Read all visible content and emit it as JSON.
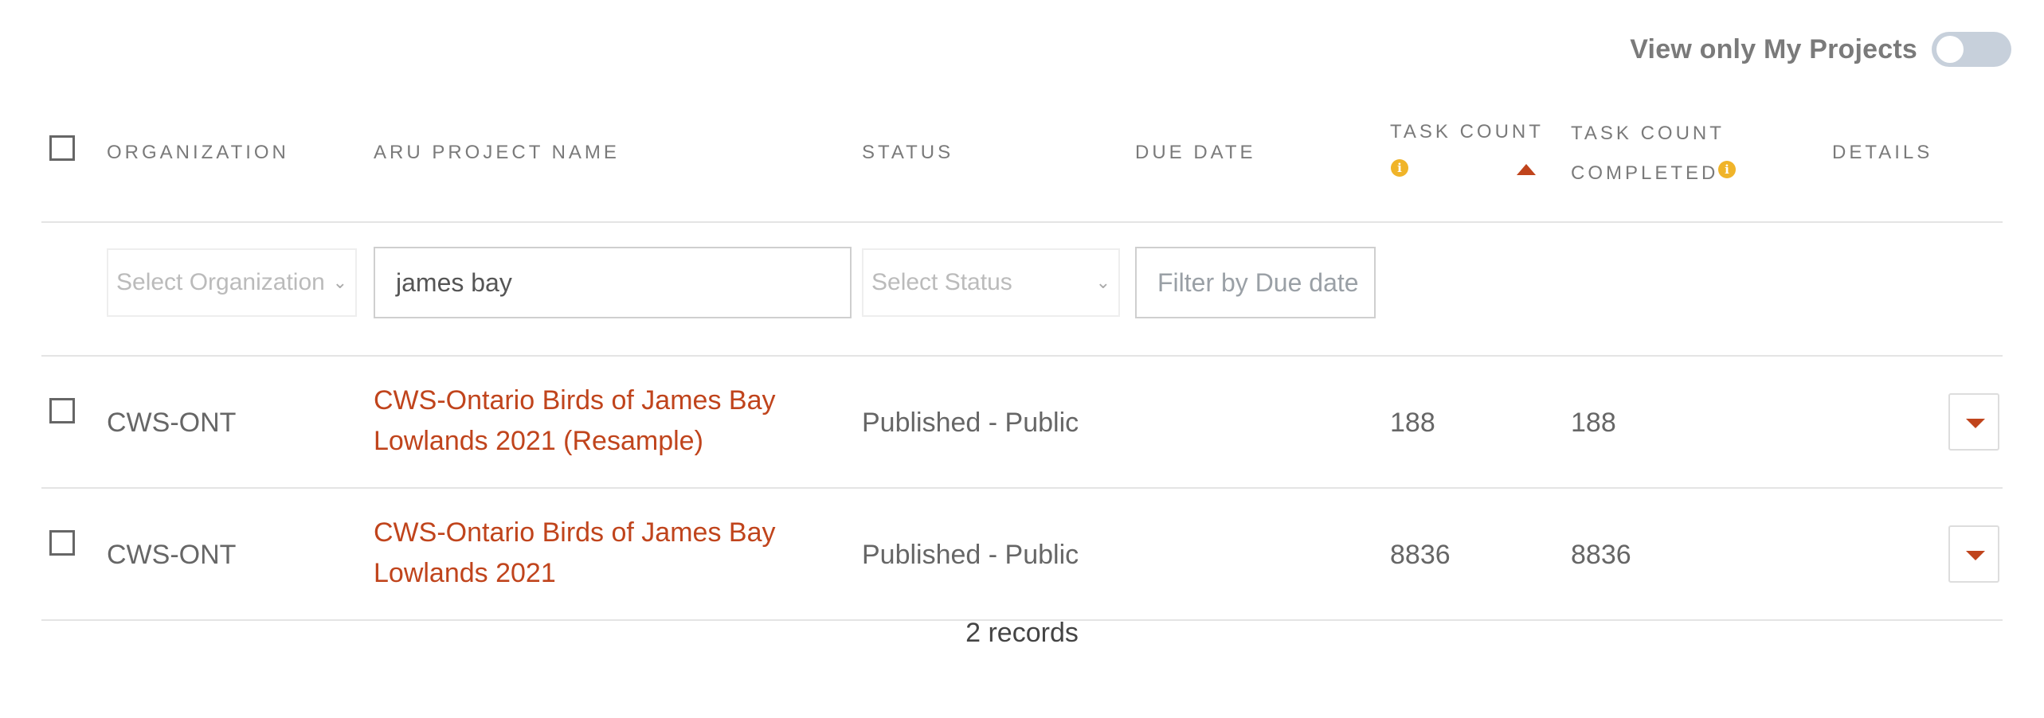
{
  "toggle": {
    "label": "View only My Projects",
    "on": false
  },
  "table": {
    "headers": {
      "organization": "ORGANIZATION",
      "project_name": "ARU PROJECT NAME",
      "status": "STATUS",
      "due_date": "DUE DATE",
      "task_count": "TASK COUNT",
      "task_count_completed_line1": "TASK COUNT",
      "task_count_completed_line2": "COMPLETED",
      "details": "DETAILS"
    },
    "filters": {
      "organization_placeholder": "Select Organization",
      "project_name_value": "james bay",
      "status_placeholder": "Select Status",
      "due_date_placeholder": "Filter by Due date"
    },
    "rows": [
      {
        "organization": "CWS-ONT",
        "project_name_line1": "CWS-Ontario Birds of James Bay",
        "project_name_line2": "Lowlands 2021 (Resample)",
        "status": "Published - Public",
        "due_date": "",
        "task_count": "188",
        "task_count_completed": "188"
      },
      {
        "organization": "CWS-ONT",
        "project_name_line1": "CWS-Ontario Birds of James Bay",
        "project_name_line2": "Lowlands 2021",
        "status": "Published - Public",
        "due_date": "",
        "task_count": "8836",
        "task_count_completed": "8836"
      }
    ],
    "records_text": "2 records"
  },
  "colors": {
    "accent": "#c0441c",
    "info": "#f0b429",
    "toggle_track": "#c7d0db"
  },
  "icons": {
    "info": "info-circle-icon",
    "sort": "sort-ascending-icon",
    "details": "caret-down-icon",
    "select_chevron": "chevron-down-icon"
  }
}
